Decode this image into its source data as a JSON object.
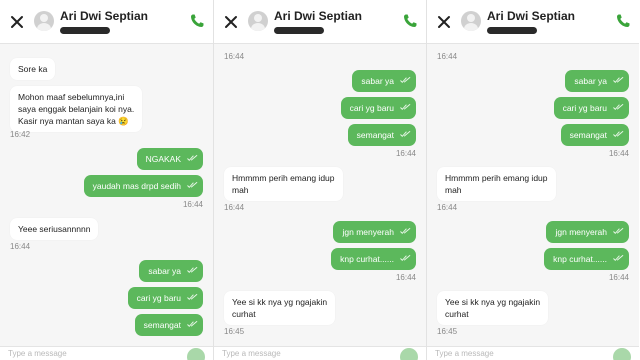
{
  "colors": {
    "accent_green": "#5cb85c",
    "background": "#f6f6f6",
    "header": "#ffffff"
  },
  "panels": [
    {
      "header": {
        "contact_name": "Ari Dwi Septian"
      },
      "messages": [
        {
          "dir": "in",
          "text": "Sore ka"
        },
        {
          "dir": "in",
          "lines": [
            "Mohon maaf sebelumnya,ini",
            "saya enggak belanjain koi nya.",
            "Kasir nya mantan saya ka 😢"
          ]
        },
        {
          "time": "16:42"
        },
        {
          "dir": "out",
          "text": "NGAKAK"
        },
        {
          "dir": "out",
          "text": "yaudah mas drpd sedih"
        },
        {
          "time": "16:44"
        },
        {
          "dir": "in",
          "text": "Yeee seriusannnnn"
        },
        {
          "time": "16:44"
        },
        {
          "dir": "out",
          "text": "sabar ya"
        },
        {
          "dir": "out",
          "text": "cari yg baru"
        },
        {
          "dir": "out",
          "text": "semangat"
        }
      ],
      "composer_placeholder": "Type a message"
    },
    {
      "header": {
        "contact_name": "Ari Dwi Septian"
      },
      "messages": [
        {
          "time": "16:44"
        },
        {
          "dir": "out",
          "text": "sabar ya"
        },
        {
          "dir": "out",
          "text": "cari yg baru"
        },
        {
          "dir": "out",
          "text": "semangat"
        },
        {
          "time": "16:44"
        },
        {
          "dir": "in",
          "lines": [
            "Hmmmm perih emang idup",
            "mah"
          ]
        },
        {
          "time": "16:44"
        },
        {
          "dir": "out",
          "text": "jgn menyerah"
        },
        {
          "dir": "out",
          "text": "knp curhat......"
        },
        {
          "time": "16:44"
        },
        {
          "dir": "in",
          "lines": [
            "Yee si kk nya yg ngajakin",
            "curhat"
          ]
        },
        {
          "time": "16:45"
        }
      ],
      "composer_placeholder": "Type a message"
    },
    {
      "header": {
        "contact_name": "Ari Dwi Septian"
      },
      "messages": [
        {
          "time": "16:44"
        },
        {
          "dir": "out",
          "text": "sabar ya"
        },
        {
          "dir": "out",
          "text": "cari yg baru"
        },
        {
          "dir": "out",
          "text": "semangat"
        },
        {
          "time": "16:44"
        },
        {
          "dir": "in",
          "lines": [
            "Hmmmm perih emang idup",
            "mah"
          ]
        },
        {
          "time": "16:44"
        },
        {
          "dir": "out",
          "text": "jgn menyerah"
        },
        {
          "dir": "out",
          "text": "knp curhat......"
        },
        {
          "time": "16:44"
        },
        {
          "dir": "in",
          "lines": [
            "Yee si kk nya yg ngajakin",
            "curhat"
          ]
        },
        {
          "time": "16:45"
        }
      ],
      "composer_placeholder": "Type a message"
    }
  ]
}
